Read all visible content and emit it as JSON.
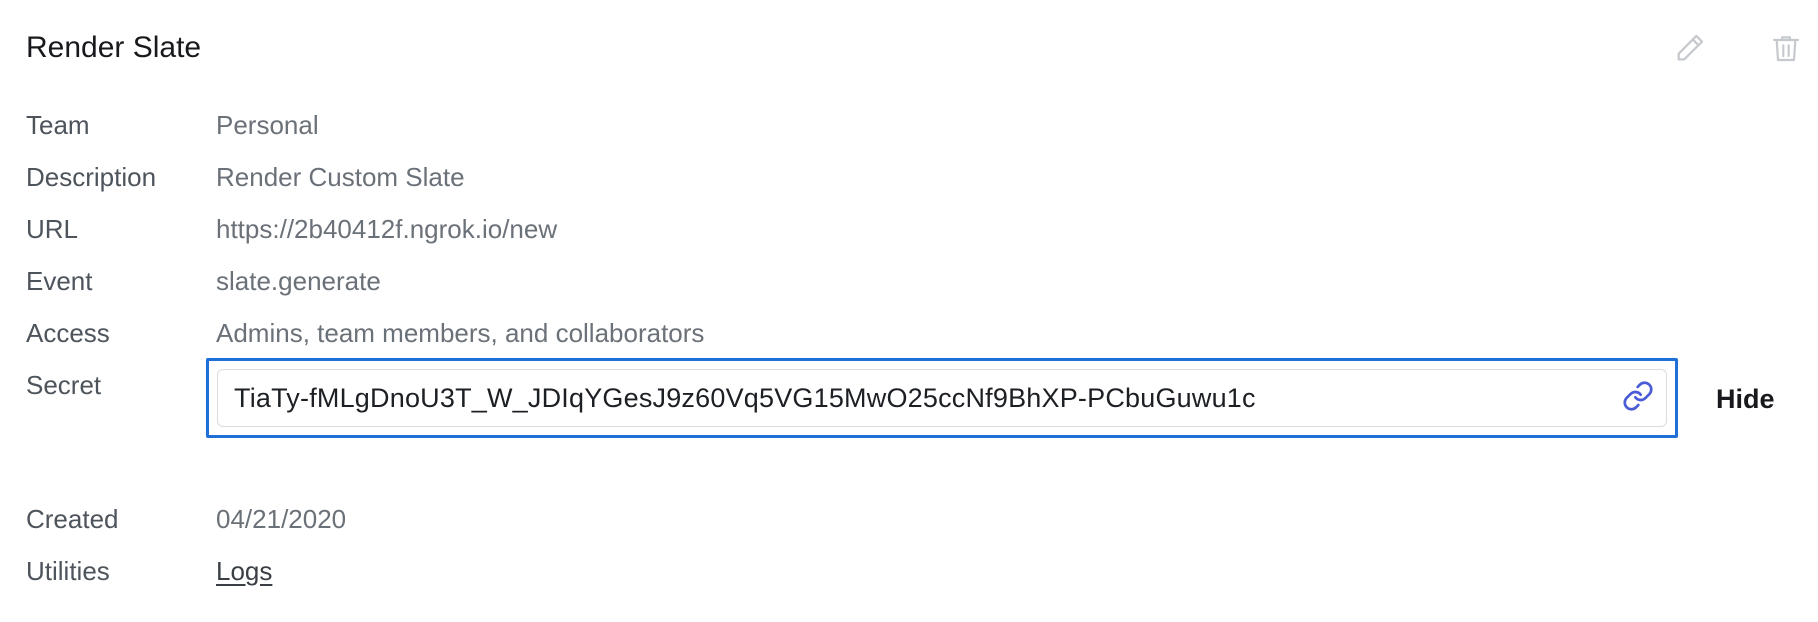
{
  "header": {
    "title": "Render Slate",
    "edit_icon": "pencil-icon",
    "delete_icon": "trash-icon"
  },
  "details": {
    "team": {
      "label": "Team",
      "value": "Personal"
    },
    "description": {
      "label": "Description",
      "value": "Render Custom Slate"
    },
    "url": {
      "label": "URL",
      "value": "https://2b40412f.ngrok.io/new"
    },
    "event": {
      "label": "Event",
      "value": "slate.generate"
    },
    "access": {
      "label": "Access",
      "value": "Admins, team members, and collaborators"
    },
    "secret": {
      "label": "Secret",
      "value": "TiaTy-fMLgDnoU3T_W_JDIqYGesJ9z60Vq5VG15MwO25ccNf9BhXP-PCbuGuwu1c",
      "copy_icon": "link-icon",
      "toggle_label": "Hide"
    },
    "created": {
      "label": "Created",
      "value": "04/21/2020"
    },
    "utilities": {
      "label": "Utilities",
      "link": "Logs"
    }
  },
  "colors": {
    "focus_border": "#1f6fd8",
    "link_icon": "#4a5bd6",
    "muted_icon": "#c5c9ce"
  }
}
